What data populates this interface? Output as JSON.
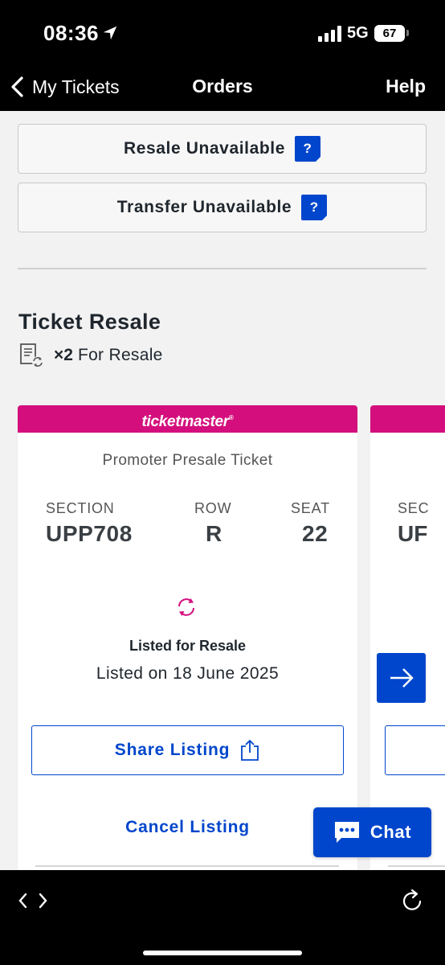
{
  "status_bar": {
    "time": "08:36",
    "network": "5G",
    "battery": "67",
    "icons": [
      "location-arrow-icon",
      "signal-icon",
      "battery-icon"
    ]
  },
  "nav": {
    "back_label": "My Tickets",
    "title": "Orders",
    "help_label": "Help"
  },
  "actions": {
    "resale_unavailable": "Resale Unavailable",
    "transfer_unavailable": "Transfer Unavailable",
    "help_icon_glyph": "?"
  },
  "resale": {
    "title": "Ticket Resale",
    "count": "×2",
    "count_label": "For Resale"
  },
  "ticket": {
    "brand": "ticketmaster",
    "brand_mark": "®",
    "type": "Promoter Presale Ticket",
    "section_label": "SECTION",
    "section_value": "UPP708",
    "row_label": "ROW",
    "row_value": "R",
    "seat_label": "SEAT",
    "seat_value": "22",
    "status": "Listed for Resale",
    "listed_date": "Listed on 18 June 2025",
    "share_label": "Share Listing",
    "cancel_label": "Cancel Listing"
  },
  "ticket2": {
    "section_label": "SEC",
    "section_value": "UF"
  },
  "chat": {
    "label": "Chat"
  },
  "colors": {
    "brand_magenta": "#d40f7d",
    "primary_blue": "#0046cc",
    "background": "#f2f2f2",
    "header_bg": "#000000"
  }
}
